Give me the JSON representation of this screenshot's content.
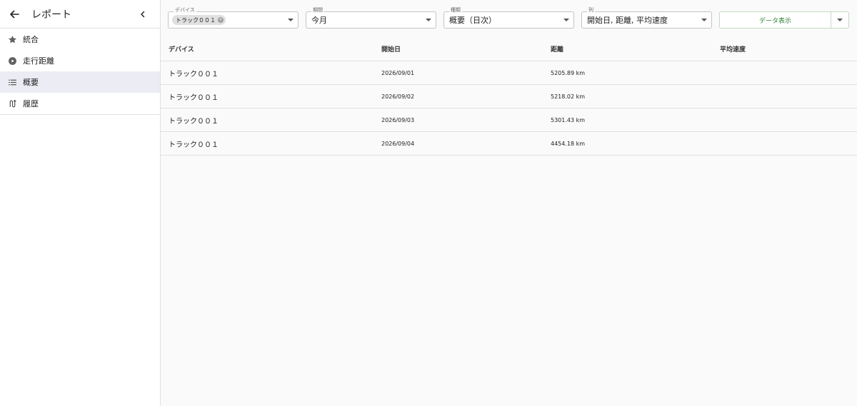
{
  "sidebar": {
    "title": "レポート",
    "items": [
      {
        "label": "統合",
        "icon": "star-icon"
      },
      {
        "label": "走行距離",
        "icon": "play-circle-icon"
      },
      {
        "label": "概要",
        "icon": "list-icon"
      },
      {
        "label": "履歴",
        "icon": "route-icon"
      }
    ],
    "active_index": 2
  },
  "filters": {
    "device": {
      "label": "デバイス",
      "chip": "トラック００１"
    },
    "period": {
      "label": "期間",
      "value": "今月"
    },
    "type": {
      "label": "種類",
      "value": "概要（日次）"
    },
    "columns": {
      "label": "列",
      "value": "開始日, 距離, 平均速度"
    },
    "show_button": "データ表示"
  },
  "table": {
    "headers": {
      "device": "デバイス",
      "start": "開始日",
      "distance": "距離",
      "speed": "平均速度"
    },
    "rows": [
      {
        "device": "トラック００１",
        "start": "2026/09/01",
        "distance": "5205.89 km",
        "speed": ""
      },
      {
        "device": "トラック００１",
        "start": "2026/09/02",
        "distance": "5218.02 km",
        "speed": ""
      },
      {
        "device": "トラック００１",
        "start": "2026/09/03",
        "distance": "5301.43 km",
        "speed": ""
      },
      {
        "device": "トラック００１",
        "start": "2026/09/04",
        "distance": "4454.18 km",
        "speed": ""
      }
    ]
  },
  "colors": {
    "accent": "#2e7d32",
    "active_bg": "#ececf4",
    "border": "#e0e0e0"
  }
}
